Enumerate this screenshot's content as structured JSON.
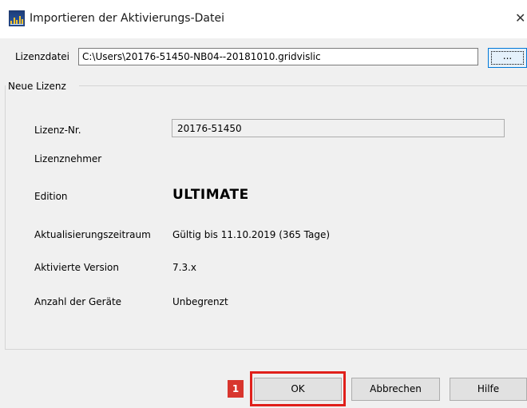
{
  "window": {
    "title": "Importieren der Aktivierungs-Datei",
    "close_symbol": "✕"
  },
  "file_row": {
    "label": "Lizenzdatei",
    "path_value": "C:\\Users\\20176-51450-NB04--20181010.gridvislic",
    "browse_label": "..."
  },
  "group": {
    "title": "Neue Lizenz",
    "fields": {
      "license_nr": {
        "label": "Lizenz-Nr.",
        "value": "20176-51450"
      },
      "licensee": {
        "label": "Lizenznehmer",
        "value": ""
      },
      "edition": {
        "label": "Edition",
        "value": "ULTIMATE"
      },
      "update_period": {
        "label": "Aktualisierungszeitraum",
        "value": "Gültig bis 11.10.2019 (365 Tage)"
      },
      "activated_version": {
        "label": "Aktivierte Version",
        "value": "7.3.x"
      },
      "device_count": {
        "label": "Anzahl der Geräte",
        "value": "Unbegrenzt"
      }
    }
  },
  "buttons": {
    "ok": "OK",
    "cancel": "Abbrechen",
    "help": "Hilfe"
  },
  "annotation": {
    "step_number": "1",
    "highlight_color": "#e0201b",
    "badge_color": "#d8362e"
  },
  "icons": {
    "app_icon": "gridvis-app-icon",
    "close_icon": "close-icon"
  }
}
